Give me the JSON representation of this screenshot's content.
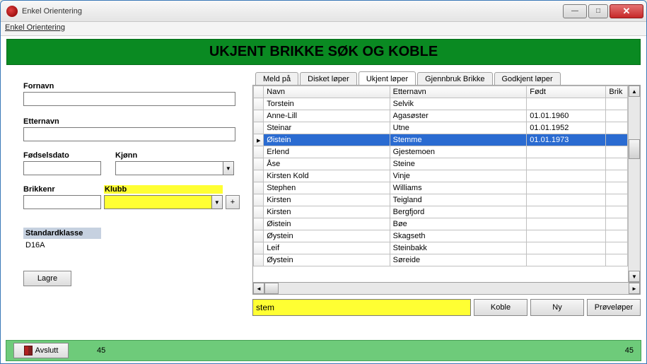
{
  "window": {
    "title": "Enkel Orientering"
  },
  "menu": {
    "item1": "Enkel Orientering"
  },
  "banner": "UKJENT BRIKKE SØK OG KOBLE",
  "form": {
    "fornavn_label": "Fornavn",
    "fornavn_value": "",
    "etternavn_label": "Etternavn",
    "etternavn_value": "",
    "fodselsdato_label": "Fødselsdato",
    "fodselsdato_value": "",
    "kjonn_label": "Kjønn",
    "kjonn_value": "",
    "brikkenr_label": "Brikkenr",
    "brikkenr_value": "",
    "klubb_label": "Klubb",
    "klubb_value": "",
    "stdklasse_label": "Standardklasse",
    "stdklasse_value": "D16A",
    "lagre_label": "Lagre"
  },
  "tabs": {
    "t0": "Meld på",
    "t1": "Disket løper",
    "t2": "Ukjent løper",
    "t3": "Gjennbruk Brikke",
    "t4": "Godkjent løper",
    "active_index": 2
  },
  "grid": {
    "columns": {
      "c0": "Navn",
      "c1": "Etternavn",
      "c2": "Født",
      "c3": "Brik"
    },
    "selected_index": 3,
    "rows": [
      {
        "navn": "Torstein",
        "etternavn": "Selvik",
        "fodt": ""
      },
      {
        "navn": "Anne-Lill",
        "etternavn": "Agasøster",
        "fodt": "01.01.1960"
      },
      {
        "navn": "Steinar",
        "etternavn": "Utne",
        "fodt": "01.01.1952"
      },
      {
        "navn": "Øistein",
        "etternavn": "Stemme",
        "fodt": "01.01.1973"
      },
      {
        "navn": "Erlend",
        "etternavn": "Gjestemoen",
        "fodt": ""
      },
      {
        "navn": "Åse",
        "etternavn": "Steine",
        "fodt": ""
      },
      {
        "navn": "Kirsten Kold",
        "etternavn": "Vinje",
        "fodt": ""
      },
      {
        "navn": "Stephen",
        "etternavn": "Williams",
        "fodt": ""
      },
      {
        "navn": "Kirsten",
        "etternavn": "Teigland",
        "fodt": ""
      },
      {
        "navn": "Kirsten",
        "etternavn": "Bergfjord",
        "fodt": ""
      },
      {
        "navn": "Øistein",
        "etternavn": "Bøe",
        "fodt": ""
      },
      {
        "navn": "Øystein",
        "etternavn": "Skagseth",
        "fodt": ""
      },
      {
        "navn": "Leif",
        "etternavn": "Steinbakk",
        "fodt": ""
      },
      {
        "navn": "Øystein",
        "etternavn": "Søreide",
        "fodt": ""
      }
    ]
  },
  "search": {
    "value": "stem"
  },
  "buttons": {
    "koble": "Koble",
    "ny": "Ny",
    "provel": "Prøveløper",
    "avslutt": "Avslutt",
    "plus": "+"
  },
  "status": {
    "left": "45",
    "right": "45"
  }
}
